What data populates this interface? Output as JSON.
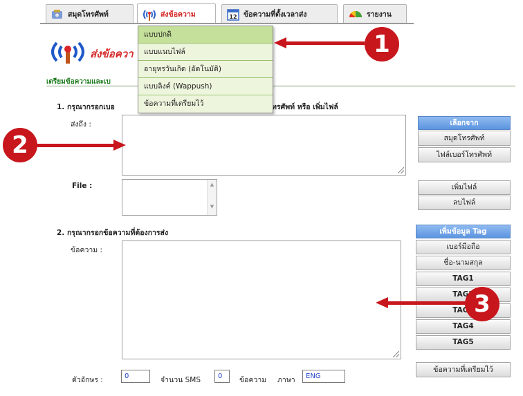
{
  "tabs": [
    {
      "label": "สมุดโทรศัพท์",
      "icon": "phonebook-icon"
    },
    {
      "label": "ส่งข้อความ",
      "icon": "antenna-icon"
    },
    {
      "label": "ข้อความที่ตั้งเวลาส่ง",
      "icon": "calendar-icon"
    },
    {
      "label": "รายงาน",
      "icon": "report-icon"
    }
  ],
  "menu": [
    "แบบปกติ",
    "แบบแนบไฟล์",
    "อายุหรวันเกิด (อัตโนมัติ)",
    "แบบลิงค์ (Wappush)",
    "ข้อความที่เตรียมไว้"
  ],
  "page": {
    "title": "ส่งข้อควา",
    "subtitle": "เตรียมข้อความและเบ"
  },
  "section1": {
    "heading_left": "1. กรุณากรอกเบอ",
    "heading_right": "ทรศัพท์ หรือ เพิ่มไฟล์",
    "to_label": "ส่งถึง :",
    "file_label": "File :"
  },
  "side1": {
    "header": "เลือกจาก",
    "phonebook": "สมุดโทรศัพท์",
    "phonefile": "ไฟล์เบอร์โทรศัพท์",
    "add_file": "เพิ่มไฟล์",
    "delete_file": "ลบไฟล์"
  },
  "section2": {
    "heading": "2. กรุณากรอกข้อความที่ต้องการส่ง",
    "message_label": "ข้อความ :"
  },
  "side2": {
    "header": "เพิ่มข้อมูล Tag",
    "tags": [
      "เบอร์มือถือ",
      "ชื่อ-นามสกุล",
      "TAG1",
      "TAG2",
      "TAG3",
      "TAG4",
      "TAG5"
    ],
    "prepared": "ข้อความที่เตรียมไว้"
  },
  "footer": {
    "chars_label": "ตัวอักษร :",
    "chars_value": "0",
    "sms_label": "จำนวน SMS",
    "sms_value": "0",
    "msg_label": "ข้อความ",
    "lang_label": "ภาษา",
    "lang_value": "ENG"
  },
  "callouts": [
    "1",
    "2",
    "3"
  ],
  "colors": {
    "accent_red": "#c8161d",
    "menu_green": "#c4e09a",
    "header_blue": "#5c95e0"
  }
}
